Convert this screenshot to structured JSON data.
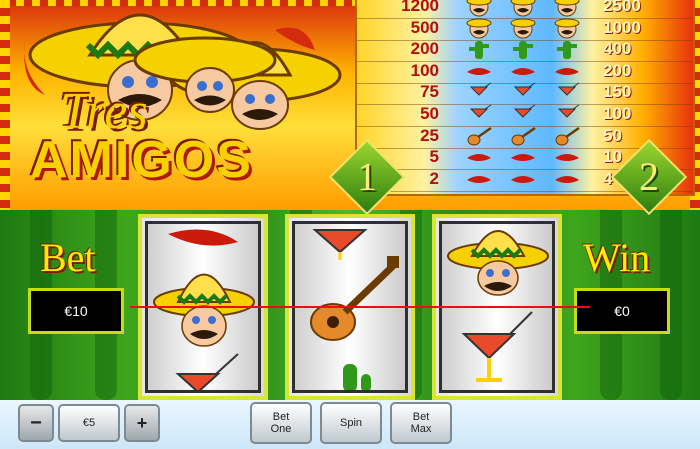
{
  "game": {
    "title_line1": "Tres",
    "title_line2": "AMIGOS"
  },
  "paytable": {
    "left_panel_number": "1",
    "right_panel_number": "2",
    "rows": [
      {
        "left": "1200",
        "symbol": "amigo-icon",
        "right": "2500"
      },
      {
        "left": "500",
        "symbol": "amigo-icon",
        "right": "1000"
      },
      {
        "left": "200",
        "symbol": "cactus-icon",
        "right": "400"
      },
      {
        "left": "100",
        "symbol": "pepper-icon",
        "right": "200"
      },
      {
        "left": "75",
        "symbol": "cocktail-icon",
        "right": "150"
      },
      {
        "left": "50",
        "symbol": "cocktail-icon",
        "right": "100"
      },
      {
        "left": "25",
        "symbol": "guitar-icon",
        "right": "50"
      },
      {
        "left": "5",
        "symbol": "pepper-icon",
        "right": "10"
      },
      {
        "left": "2",
        "symbol": "pepper-icon",
        "right": "4"
      }
    ]
  },
  "bet": {
    "label": "Bet",
    "value": "€10"
  },
  "win": {
    "label": "Win",
    "value": "€0"
  },
  "reels": [
    {
      "top": "pepper-icon",
      "middle": "amigo-icon",
      "bottom": "cocktail-icon"
    },
    {
      "top": "cocktail-icon",
      "middle": "guitar-icon",
      "bottom": "cactus-icon"
    },
    {
      "top": "amigo-icon",
      "middle": "cocktail-icon",
      "bottom": "blank"
    }
  ],
  "controls": {
    "decrease": "−",
    "coin_value": "€5",
    "increase": "+",
    "bet_one_line1": "Bet",
    "bet_one_line2": "One",
    "spin": "Spin",
    "bet_max_line1": "Bet",
    "bet_max_line2": "Max"
  }
}
